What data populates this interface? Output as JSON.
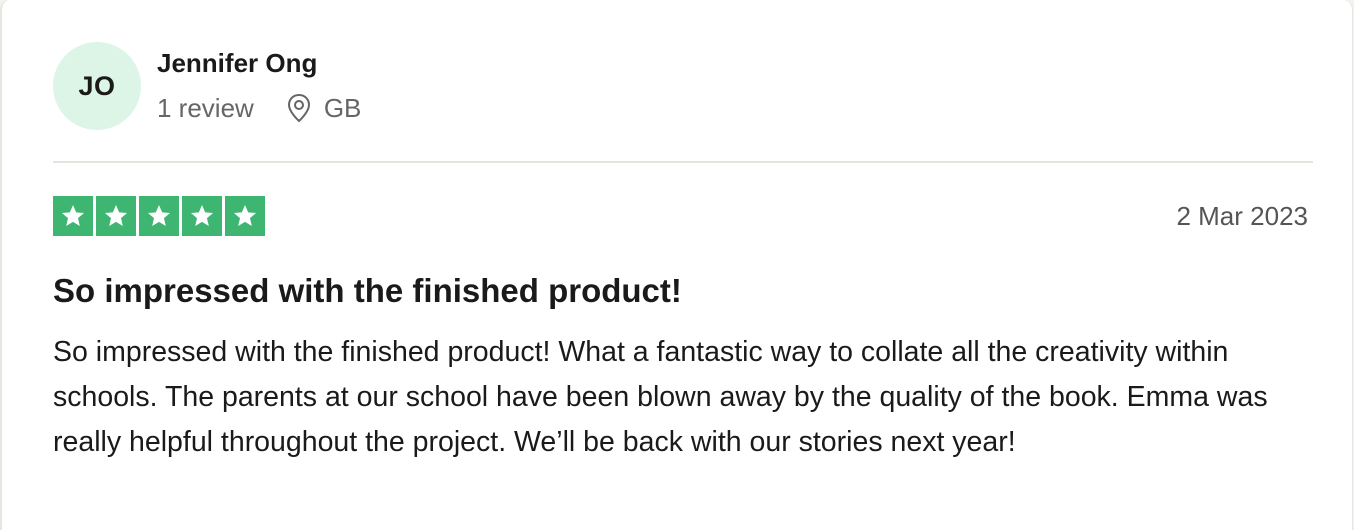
{
  "reviewer": {
    "initials": "JO",
    "name": "Jennifer Ong",
    "review_count": "1 review",
    "country": "GB",
    "avatar_color": "#dcf5e7"
  },
  "review": {
    "rating": 5,
    "max_rating": 5,
    "star_color": "#3fb572",
    "date": "2 Mar 2023",
    "title": "So impressed with the finished product!",
    "text": "So impressed with the finished product! What a fantastic way to collate all the creativity within schools. The parents at our school have been blown away by the quality of the book. Emma was really helpful throughout the project. We’ll be back with our stories next year!"
  },
  "icons": {
    "location": "location-pin-icon",
    "star": "star-icon"
  }
}
